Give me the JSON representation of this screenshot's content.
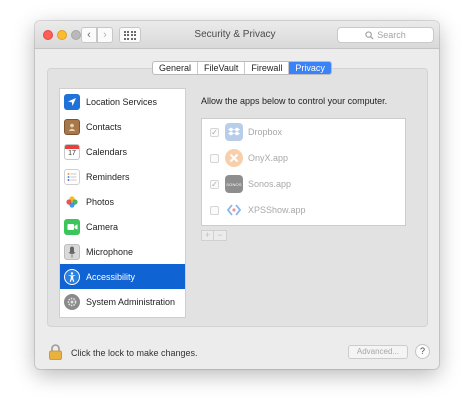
{
  "window": {
    "title": "Security & Privacy"
  },
  "search": {
    "placeholder": "Search"
  },
  "tabs": [
    {
      "label": "General",
      "active": false
    },
    {
      "label": "FileVault",
      "active": false
    },
    {
      "label": "Firewall",
      "active": false
    },
    {
      "label": "Privacy",
      "active": true
    }
  ],
  "sidebar": {
    "items": [
      {
        "label": "Location Services",
        "icon": "location-arrow-icon"
      },
      {
        "label": "Contacts",
        "icon": "contacts-book-icon"
      },
      {
        "label": "Calendars",
        "icon": "calendar-icon",
        "icon_text": "17"
      },
      {
        "label": "Reminders",
        "icon": "reminders-icon"
      },
      {
        "label": "Photos",
        "icon": "photos-icon"
      },
      {
        "label": "Camera",
        "icon": "camera-icon"
      },
      {
        "label": "Microphone",
        "icon": "microphone-icon"
      },
      {
        "label": "Accessibility",
        "icon": "accessibility-icon",
        "selected": true
      },
      {
        "label": "System Administration",
        "icon": "system-administration-icon"
      }
    ]
  },
  "main": {
    "prompt": "Allow the apps below to control your computer.",
    "apps": [
      {
        "name": "Dropbox",
        "checked": true,
        "icon": "dropbox-icon"
      },
      {
        "name": "OnyX.app",
        "checked": false,
        "icon": "onyx-icon"
      },
      {
        "name": "Sonos.app",
        "checked": true,
        "icon": "sonos-icon",
        "icon_text": "SONOS"
      },
      {
        "name": "XPSShow.app",
        "checked": false,
        "icon": "xpsshow-icon"
      }
    ],
    "add_label": "+",
    "remove_label": "−"
  },
  "footer": {
    "lock_text": "Click the lock to make changes.",
    "advanced_label": "Advanced...",
    "help_label": "?"
  },
  "colors": {
    "accent": "#0f63d3",
    "tab_active": "#3a82f7"
  }
}
